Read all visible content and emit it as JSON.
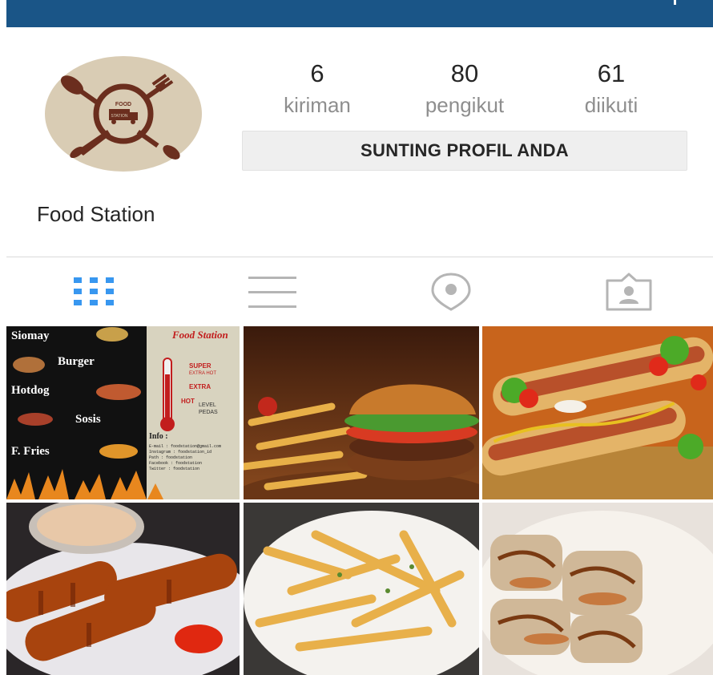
{
  "profile": {
    "name": "Food Station",
    "avatar_icon": "food-station-logo",
    "logo_text": [
      "FOOD",
      "STATION"
    ]
  },
  "stats": [
    {
      "value": "6",
      "label": "kiriman"
    },
    {
      "value": "80",
      "label": "pengikut"
    },
    {
      "value": "61",
      "label": "diikuti"
    }
  ],
  "edit_button": {
    "label": "SUNTING PROFIL ANDA"
  },
  "tabs": [
    {
      "icon": "grid-icon",
      "active": true
    },
    {
      "icon": "list-icon",
      "active": false
    },
    {
      "icon": "location-pin-icon",
      "active": false
    },
    {
      "icon": "tagged-person-icon",
      "active": false
    }
  ],
  "colors": {
    "header": "#1a5587",
    "active_tab": "#3897f0",
    "inactive_tab": "#b5b5b5",
    "button_bg": "#efefef"
  },
  "posts": [
    {
      "type": "menu-poster",
      "menu_items": [
        "Siomay",
        "Burger",
        "Hotdog",
        "Sosis",
        "F. Fries"
      ],
      "brand": "Food Station",
      "heat_levels": [
        "SUPER",
        "EXTRA HOT",
        "EXTRA",
        "HOT",
        "LEVEL",
        "PEDAS"
      ],
      "info_title": "Info :",
      "info_lines": [
        "E-mail    : foodstation@gmail.com",
        "Instagram : foodstation_id",
        "Path      : foodstation",
        "Facebook  : foodstation",
        "Twitter   : foodstation"
      ]
    },
    {
      "type": "photo",
      "subject": "burger-with-fries"
    },
    {
      "type": "photo",
      "subject": "hotdogs"
    },
    {
      "type": "photo",
      "subject": "sausages-with-sauce"
    },
    {
      "type": "photo",
      "subject": "french-fries"
    },
    {
      "type": "photo",
      "subject": "siomay-with-peanut-sauce"
    }
  ]
}
